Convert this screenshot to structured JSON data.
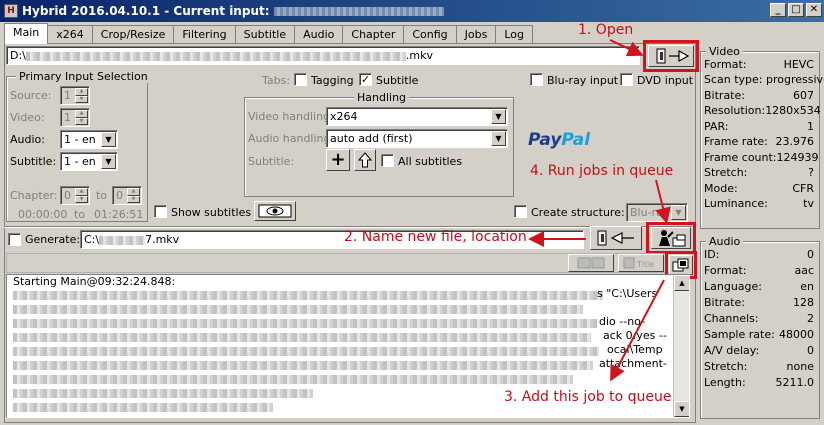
{
  "window": {
    "title": "Hybrid 2016.04.10.1 - Current input:",
    "buttons": [
      "_",
      "□",
      "✕"
    ]
  },
  "tabs": [
    "Main",
    "x264",
    "Crop/Resize",
    "Filtering",
    "Subtitle",
    "Audio",
    "Chapter",
    "Config",
    "Jobs",
    "Log"
  ],
  "input": {
    "path_start": "D:\\",
    "path_end": ".mkv"
  },
  "primary": {
    "title": "Primary Input Selection",
    "source_label": "Source:",
    "source_value": "1",
    "video_label": "Video:",
    "video_value": "1",
    "audio_label": "Audio:",
    "audio_value": "1 - en",
    "subtitle_label": "Subtitle:",
    "subtitle_value": "1 - en",
    "chapter_label": "Chapter:",
    "chapter_from": "0",
    "to_label": "to",
    "chapter_to": "0",
    "time_start": "00:00:00",
    "time_to": "to",
    "time_end": "01:26:51"
  },
  "tabs_opts": {
    "label": "Tabs:",
    "tagging": "Tagging",
    "subtitle": "Subtitle"
  },
  "bluray": "Blu-ray input",
  "dvd": "DVD input",
  "handling": {
    "title": "Handling",
    "video_label": "Video handling:",
    "video_value": "x264",
    "audio_label": "Audio handling:",
    "audio_value": "auto add (first)",
    "subtitle_label": "Subtitle:",
    "all_subs": "All subtitles"
  },
  "show_subtitles": "Show subtitles",
  "create_structure": "Create structure:",
  "structure_value": "Blu-ray",
  "paypal": {
    "a": "Pay",
    "b": "Pal"
  },
  "generate": {
    "label": "Generate:",
    "path": "C:\\",
    "path_end": "7.mkv"
  },
  "log": {
    "first_line": "Starting Main@09:32:24.848:",
    "fragments": [
      "s \"C:\\Users",
      "dio --no-",
      "ack 0:yes --",
      "ocal\\Temp",
      "attachment-"
    ]
  },
  "video_info": {
    "title": "Video",
    "rows": [
      [
        "Format:",
        "HEVC"
      ],
      [
        "Scan type: progressive",
        ""
      ],
      [
        "Bitrate:",
        "607"
      ],
      [
        "Resolution:",
        "1280x534"
      ],
      [
        "PAR:",
        "1"
      ],
      [
        "Frame rate:",
        "23.976"
      ],
      [
        "Frame count:",
        "124939"
      ],
      [
        "Stretch:",
        "?"
      ],
      [
        "Mode:",
        "CFR"
      ],
      [
        "Luminance:",
        "tv"
      ]
    ]
  },
  "audio_info": {
    "title": "Audio",
    "rows": [
      [
        "ID:",
        "0"
      ],
      [
        "Format:",
        "aac"
      ],
      [
        "Language:",
        "en"
      ],
      [
        "Bitrate:",
        "128"
      ],
      [
        "Channels:",
        "2"
      ],
      [
        "Sample rate:",
        "48000"
      ],
      [
        "A/V delay:",
        "0"
      ],
      [
        "Stretch:",
        "none"
      ],
      [
        "Length:",
        "5211.0"
      ]
    ]
  },
  "annotations": {
    "open": "1. Open",
    "name": "2. Name new file, location",
    "add": "3. Add this job to queue",
    "run": "4. Run jobs in queue"
  },
  "colors": {
    "accent": "#d0141e",
    "titlebar": "#0a246a"
  }
}
